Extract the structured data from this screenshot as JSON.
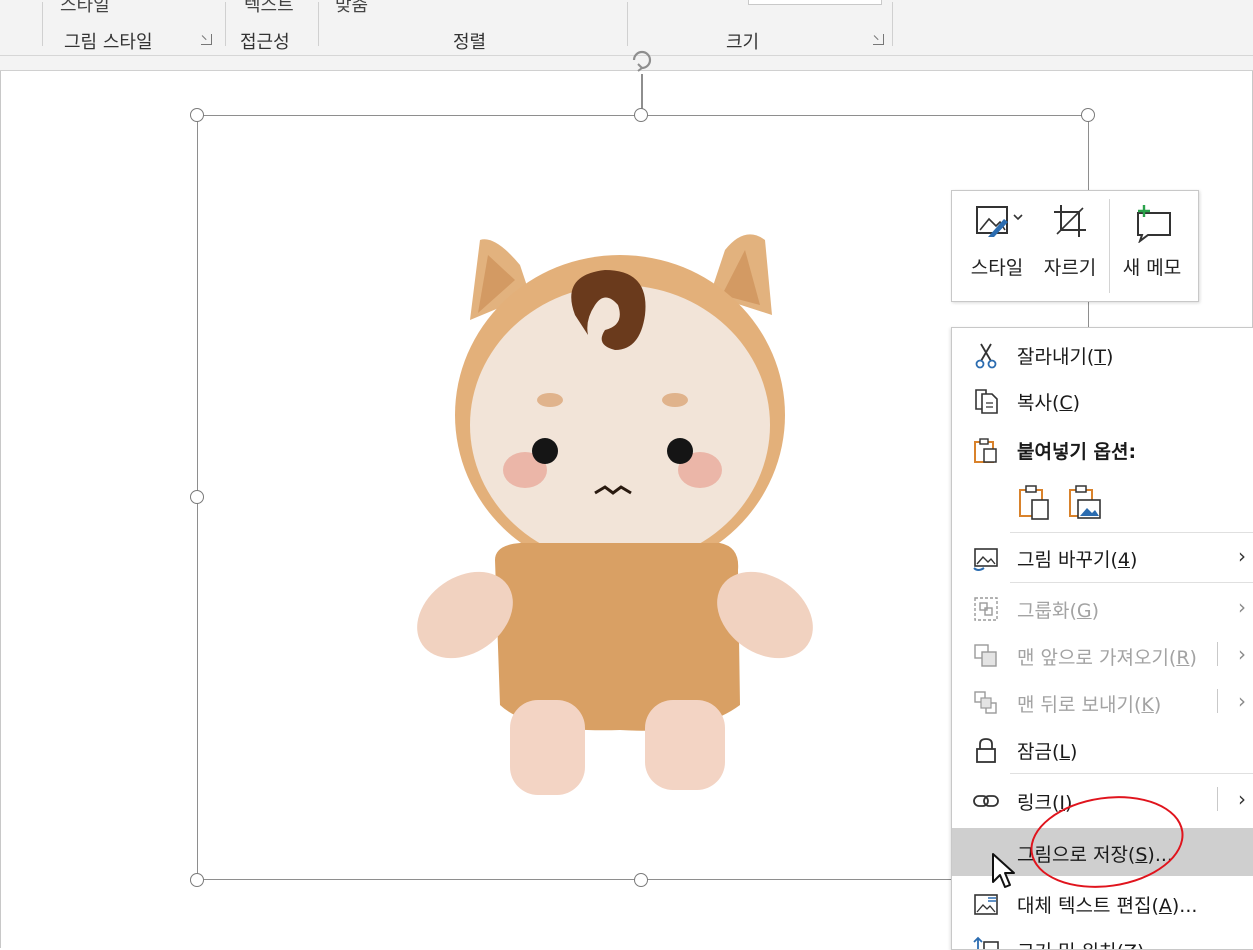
{
  "ribbon": {
    "top_fragments": [
      "스타일",
      "텍스트",
      "맞춤"
    ],
    "groups": {
      "picture_styles": "그림 스타일",
      "accessibility": "접근성",
      "arrange": "정렬",
      "size": "크기"
    }
  },
  "mini_toolbar": {
    "style": "스타일",
    "crop": "자르기",
    "new_comment": "새 메모"
  },
  "context_menu": {
    "cut": {
      "label": "잘라내기",
      "key": "T"
    },
    "copy": {
      "label": "복사",
      "key": "C"
    },
    "paste_options": {
      "label": "붙여넣기 옵션:"
    },
    "change_picture": {
      "label": "그림 바꾸기",
      "key": "4"
    },
    "group": {
      "label": "그룹화",
      "key": "G"
    },
    "bring_to_front": {
      "label": "맨 앞으로 가져오기",
      "key": "R"
    },
    "send_to_back": {
      "label": "맨 뒤로 보내기",
      "key": "K"
    },
    "lock": {
      "label": "잠금",
      "key": "L"
    },
    "link": {
      "label": "링크",
      "key": "I"
    },
    "save_as_picture": {
      "label": "그림으로 저장",
      "key": "S",
      "suffix": "..."
    },
    "edit_alt_text": {
      "label": "대체 텍스트 편집",
      "key": "A",
      "suffix": "..."
    },
    "size_and_position": {
      "label": "크기 및 위치",
      "key": "Z"
    }
  },
  "colors": {
    "highlight": "#cfcfcf",
    "annotation_red": "#e0141d",
    "paste_orange": "#d9822b",
    "accent_blue": "#2b6cb0"
  }
}
